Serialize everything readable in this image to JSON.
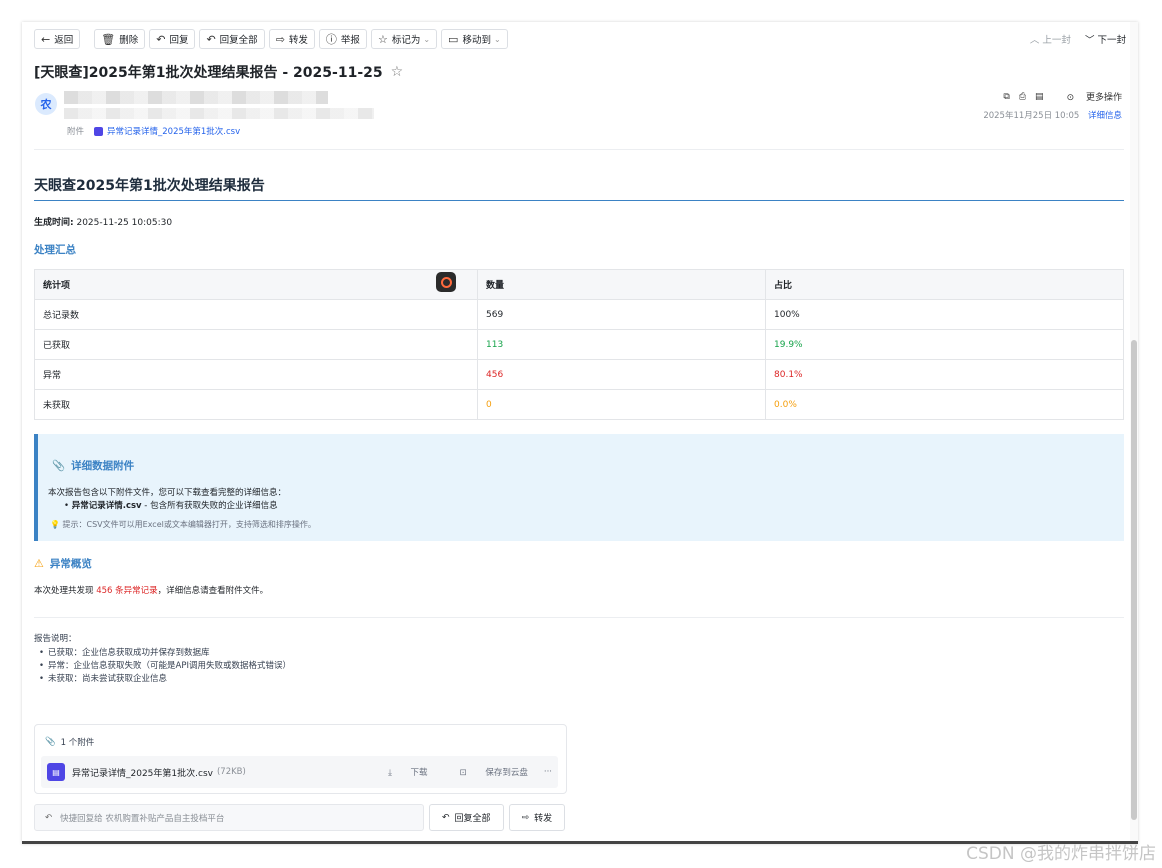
{
  "toolbar": {
    "back": "返回",
    "delete": "删除",
    "reply": "回复",
    "reply_all": "回复全部",
    "forward": "转发",
    "report": "举报",
    "mark_as": "标记为",
    "move_to": "移动到",
    "prev": "上一封",
    "next": "下一封"
  },
  "email": {
    "subject": "[天眼查]2025年第1批次处理结果报告 - 2025-11-25",
    "avatar_letter": "农",
    "attachment_label": "附件",
    "attachment_name": "异常记录详情_2025年第1批次.csv",
    "more_actions": "更多操作",
    "datetime": "2025年11月25日 10:05",
    "detail_link": "详细信息"
  },
  "report": {
    "title": "天眼查2025年第1批次处理结果报告",
    "gen_label": "生成时间:",
    "gen_time": "2025-11-25 10:05:30",
    "summary_heading": "处理汇总",
    "table": {
      "headers": [
        "统计项",
        "数量",
        "占比"
      ],
      "rows": [
        {
          "item": "总记录数",
          "count": "569",
          "ratio": "100%",
          "color": "#1f2328"
        },
        {
          "item": "已获取",
          "count": "113",
          "ratio": "19.9%",
          "color": "#16a34a"
        },
        {
          "item": "异常",
          "count": "456",
          "ratio": "80.1%",
          "color": "#dc2626"
        },
        {
          "item": "未获取",
          "count": "0",
          "ratio": "0.0%",
          "color": "#f59e0b"
        }
      ]
    },
    "attach_box": {
      "title": "详细数据附件",
      "text": "本次报告包含以下附件文件，您可以下载查看完整的详细信息：",
      "bullet_file": "异常记录详情.csv",
      "bullet_desc": " - 包含所有获取失败的企业详细信息",
      "tip": "提示：CSV文件可以用Excel或文本编辑器打开，支持筛选和排序操作。"
    },
    "abnormal": {
      "heading": "异常概览",
      "prefix": "本次处理共发现 ",
      "highlight": "456 条异常记录",
      "suffix": "，详细信息请查看附件文件。"
    },
    "notes": {
      "title": "报告说明：",
      "items": [
        "已获取：企业信息获取成功并保存到数据库",
        "异常：企业信息获取失败（可能是API调用失败或数据格式错误）",
        "未获取：尚未尝试获取企业信息"
      ]
    }
  },
  "attachments": {
    "count_label": "1 个附件",
    "file_name": "异常记录详情_2025年第1批次.csv",
    "file_size": "(72KB)",
    "download": "下载",
    "save_cloud": "保存到云盘",
    "more": "···"
  },
  "reply_bar": {
    "placeholder": "快捷回复给 农机购置补贴产品自主投档平台",
    "reply_all": "回复全部",
    "forward": "转发"
  },
  "watermark": "CSDN @我的炸串拌饼店",
  "colors": {
    "accent": "#3b82c4",
    "green": "#16a34a",
    "red": "#dc2626",
    "orange": "#f59e0b"
  }
}
